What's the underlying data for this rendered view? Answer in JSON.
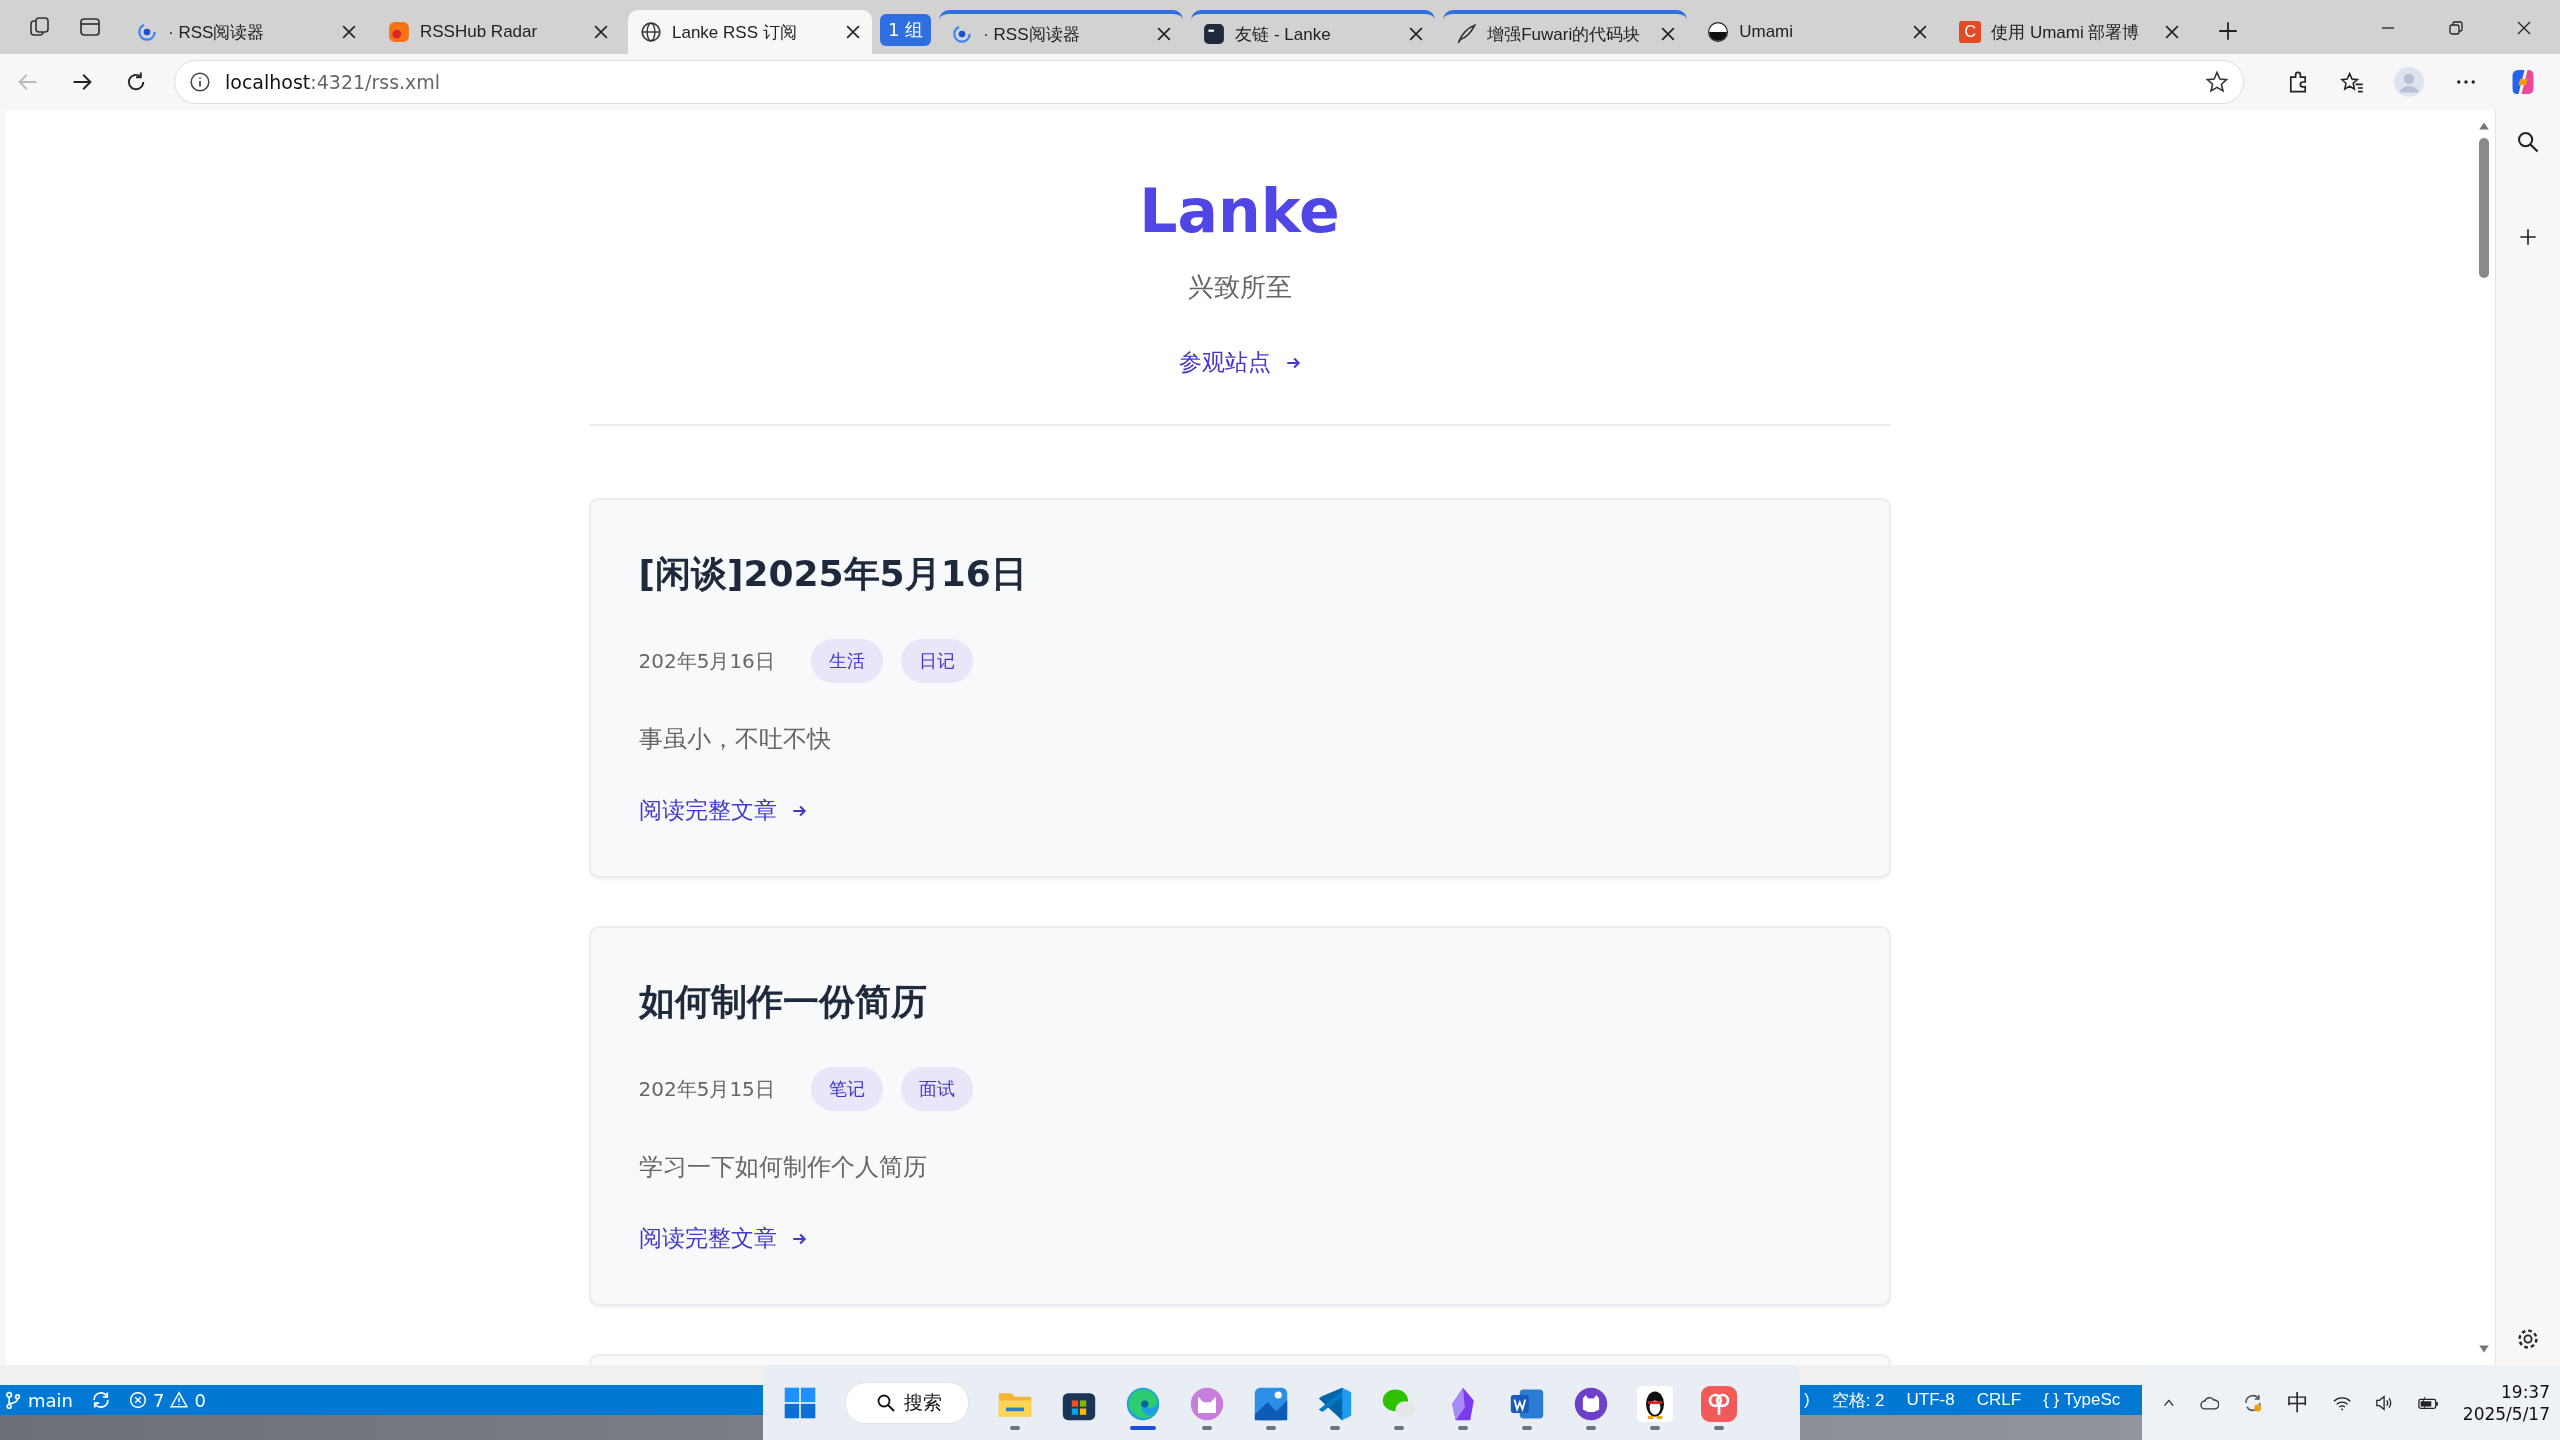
{
  "browser": {
    "tabs": [
      {
        "title": "· RSS阅读器",
        "selected": false,
        "grouped": false
      },
      {
        "title": "RSSHub Radar",
        "selected": false,
        "grouped": false
      },
      {
        "title": "Lanke RSS 订阅",
        "selected": true,
        "grouped": false
      },
      {
        "title": "· RSS阅读器",
        "selected": false,
        "grouped": true,
        "group_label": "1 组"
      },
      {
        "title": "友链 - Lanke",
        "selected": false,
        "grouped": true
      },
      {
        "title": "增强Fuwari的代码块",
        "selected": false,
        "grouped": true
      },
      {
        "title": "Umami",
        "selected": false,
        "grouped": false
      },
      {
        "title": "使用 Umami 部署博",
        "letter": "C",
        "selected": false,
        "grouped": false
      }
    ],
    "address": {
      "host": "localhost",
      "rest": ":4321/rss.xml"
    }
  },
  "page": {
    "site_title": "Lanke",
    "subtitle": "兴致所至",
    "visit_link": "参观站点",
    "posts": [
      {
        "title": "[闲谈]2025年5月16日",
        "date": "202年5月16日",
        "tags": [
          "生活",
          "日记"
        ],
        "summary": "事虽小，不吐不快",
        "read_more": "阅读完整文章"
      },
      {
        "title": "如何制作一份简历",
        "date": "202年5月15日",
        "tags": [
          "笔记",
          "面试"
        ],
        "summary": "学习一下如何制作个人简历",
        "read_more": "阅读完整文章"
      }
    ]
  },
  "editor_status": {
    "branch": "main",
    "errors": "7",
    "warnings": "0",
    "right_items": [
      ")",
      "空格: 2",
      "UTF-8",
      "CRLF",
      "{ } TypeSc"
    ]
  },
  "taskbar": {
    "search": "搜索",
    "apps": [
      {
        "kind": "folder",
        "running": true,
        "active": false
      },
      {
        "kind": "store",
        "running": false,
        "active": false
      },
      {
        "kind": "browser",
        "running": true,
        "active": true
      },
      {
        "kind": "cat",
        "running": true,
        "active": false
      },
      {
        "kind": "photos",
        "running": true,
        "active": false
      },
      {
        "kind": "code",
        "running": true,
        "active": false
      },
      {
        "kind": "chat",
        "running": true,
        "active": false
      },
      {
        "kind": "crystal",
        "running": true,
        "active": false
      },
      {
        "kind": "word",
        "running": true,
        "active": false
      },
      {
        "kind": "octocat",
        "running": true,
        "active": false
      },
      {
        "kind": "penguin",
        "running": true,
        "active": false
      },
      {
        "kind": "flower",
        "running": true,
        "active": false
      }
    ]
  },
  "tray": {
    "ime": "中",
    "time": "19:37",
    "date": "2025/5/17"
  }
}
